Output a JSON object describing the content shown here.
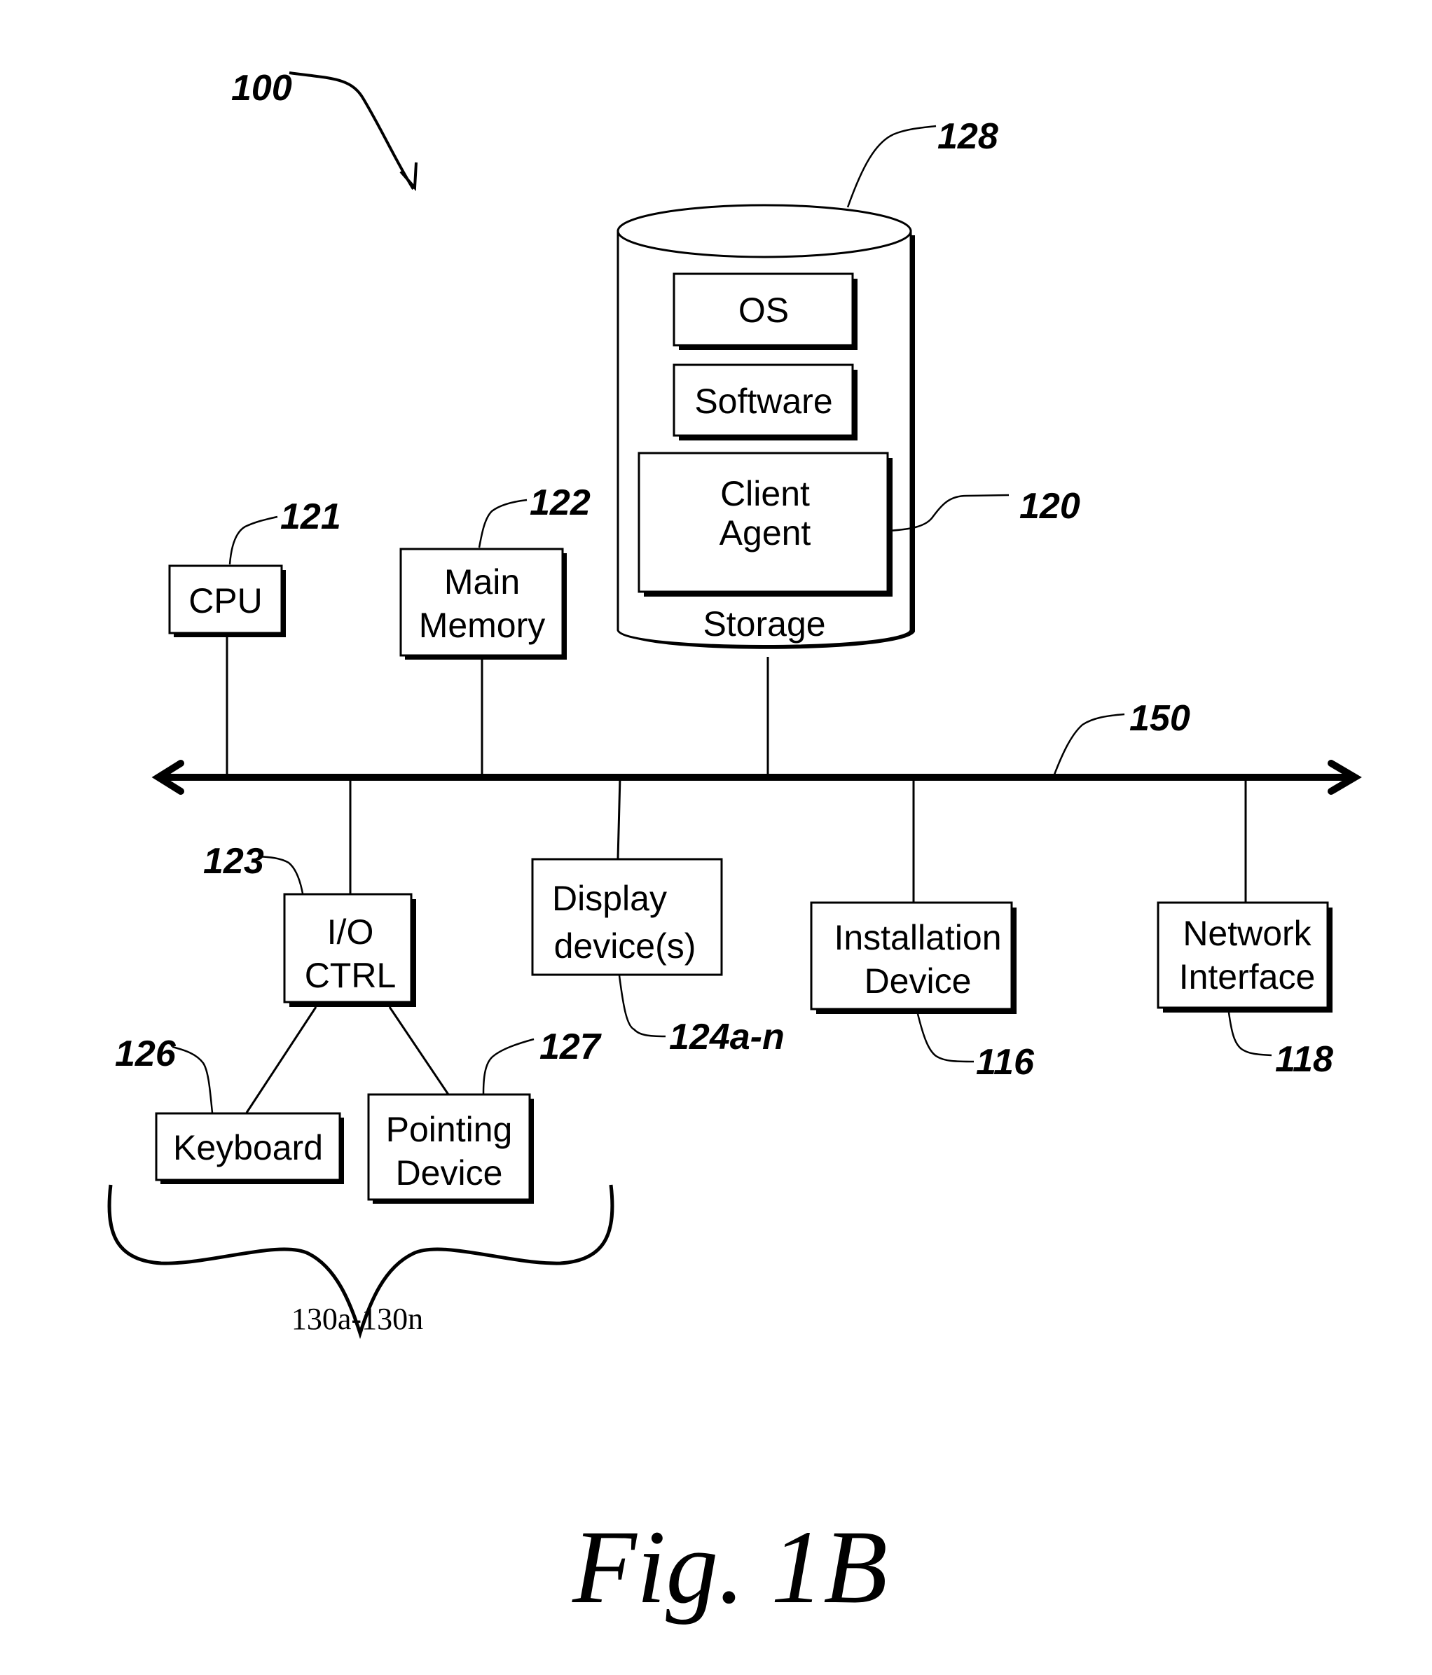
{
  "figure": {
    "caption": "Fig. 1B",
    "system_ref": "100"
  },
  "storage": {
    "label": "Storage",
    "ref": "128",
    "items": [
      {
        "label": "OS"
      },
      {
        "label": "Software"
      },
      {
        "label_lines": [
          "Client",
          "Agent"
        ],
        "ref": "120"
      }
    ]
  },
  "components": {
    "cpu": {
      "label_lines": [
        "CPU"
      ],
      "ref": "121"
    },
    "main_memory": {
      "label_lines": [
        "Main",
        "Memory"
      ],
      "ref": "122"
    },
    "io_ctrl": {
      "label_lines": [
        "I/O",
        "CTRL"
      ],
      "ref": "123"
    },
    "display": {
      "label_lines": [
        "Display",
        "device(s)"
      ],
      "ref": "124a-n"
    },
    "installation": {
      "label_lines": [
        "Installation",
        "Device"
      ],
      "ref": "116"
    },
    "network": {
      "label_lines": [
        "Network",
        "Interface"
      ],
      "ref": "118"
    },
    "keyboard": {
      "label_lines": [
        "Keyboard"
      ],
      "ref": "126"
    },
    "pointing": {
      "label_lines": [
        "Pointing",
        "Device"
      ],
      "ref": "127"
    }
  },
  "bus": {
    "ref": "150"
  },
  "io_devices_group": {
    "label": "130a-130n"
  }
}
